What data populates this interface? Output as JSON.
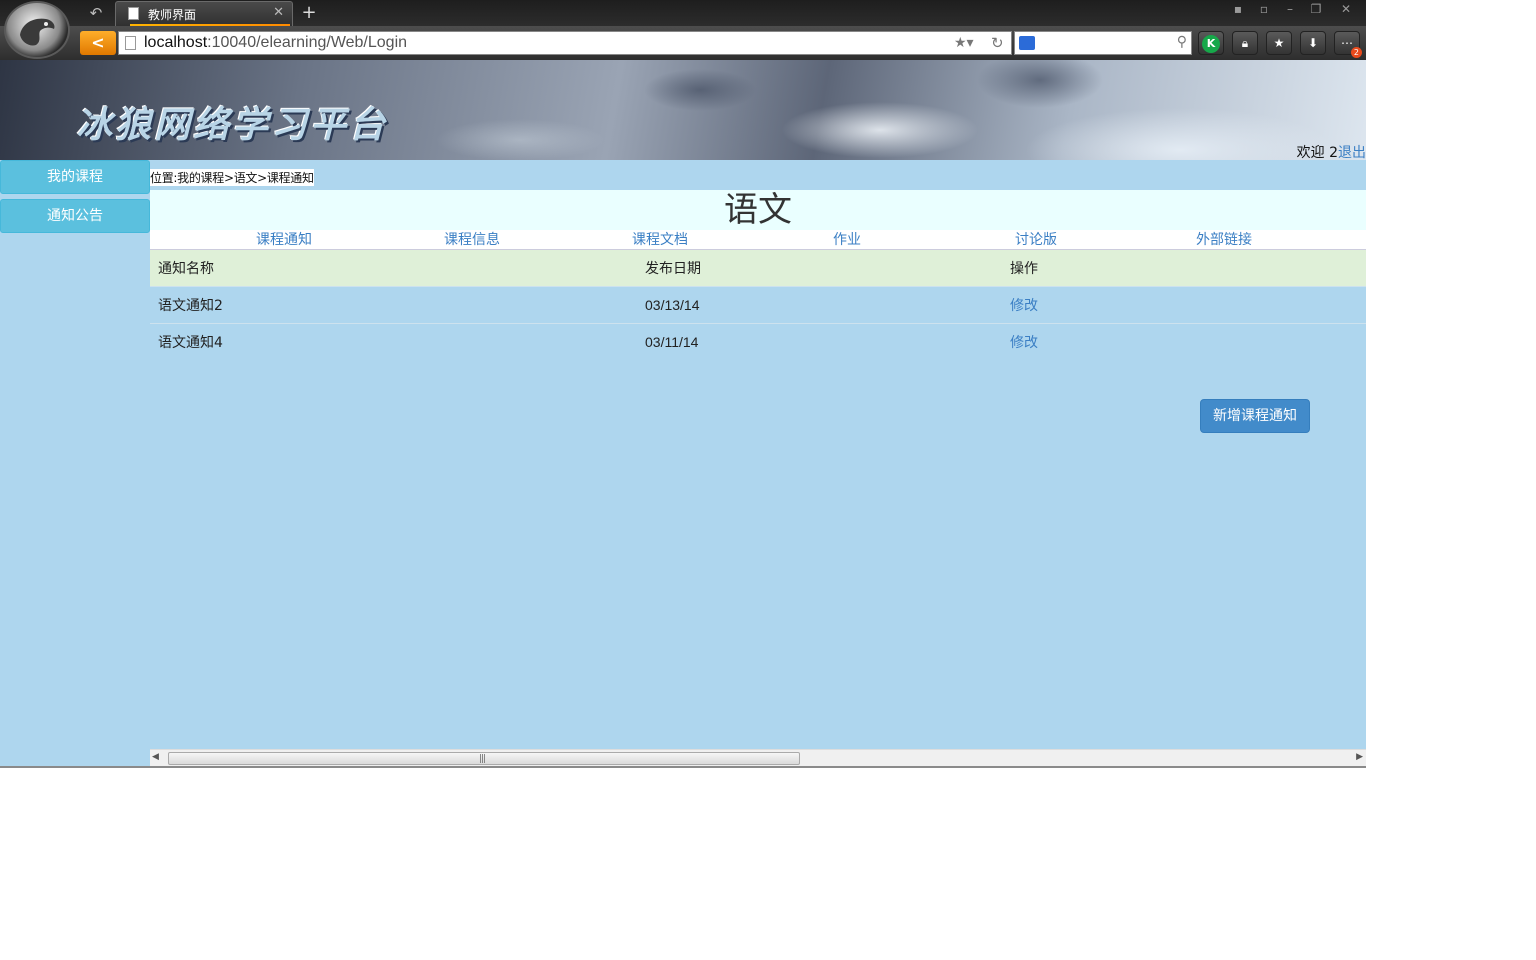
{
  "browser": {
    "tab_title": "教师界面",
    "tab_close": "✕",
    "new_tab": "+",
    "url_host": "localhost",
    "url_rest": ":10040/elearning/Web/Login",
    "back_glyph": "<",
    "undo_glyph": "↶",
    "badge_count": "2",
    "window_controls": [
      "▪",
      "▫",
      "–",
      "❐",
      "✕"
    ]
  },
  "header": {
    "site_title": "冰狼网络学习平台",
    "welcome_text": "欢迎 2",
    "logout_label": "退出"
  },
  "sidebar": {
    "items": [
      {
        "label": "我的课程"
      },
      {
        "label": "通知公告"
      }
    ]
  },
  "breadcrumb": "位置:我的课程>语文>课程通知",
  "course": {
    "title": "语文",
    "nav": [
      {
        "label": "课程通知"
      },
      {
        "label": "课程信息"
      },
      {
        "label": "课程文档"
      },
      {
        "label": "作业"
      },
      {
        "label": "讨论版"
      },
      {
        "label": "外部链接"
      }
    ]
  },
  "notices": {
    "columns": [
      "通知名称",
      "发布日期",
      "操作"
    ],
    "rows": [
      {
        "name": "语文通知2",
        "date": "03/13/14",
        "action": "修改"
      },
      {
        "name": "语文通知4",
        "date": "03/11/14",
        "action": "修改"
      }
    ]
  },
  "add_button_label": "新增课程通知",
  "colors": {
    "page_bg": "#aed6ee",
    "sidebar_button": "#5bc0de",
    "primary_button": "#428bca",
    "link": "#3b7fc4",
    "table_header_bg": "#dff0d8",
    "title_bar_bg": "#eaffff"
  }
}
